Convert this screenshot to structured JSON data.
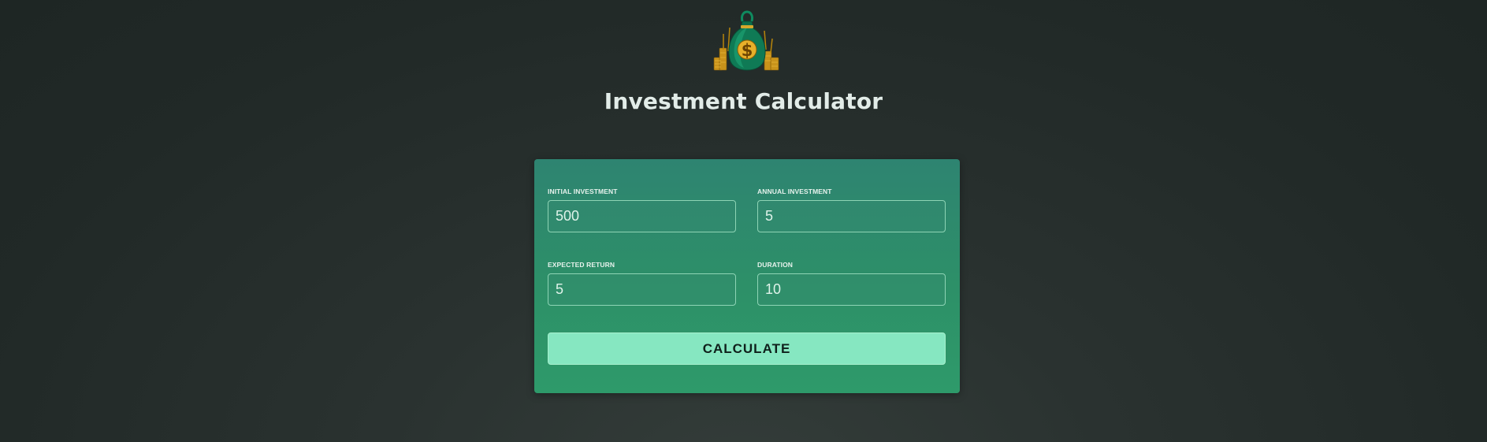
{
  "header": {
    "logo_icon": "money-bag-icon",
    "title": "Investment Calculator"
  },
  "form": {
    "initial_investment": {
      "label": "Initial Investment",
      "value": "500"
    },
    "annual_investment": {
      "label": "Annual Investment",
      "value": "5"
    },
    "expected_return": {
      "label": "Expected Return",
      "value": "5"
    },
    "duration": {
      "label": "Duration",
      "value": "10"
    },
    "calculate_label": "CALCULATE"
  },
  "colors": {
    "background": "#222a28",
    "card": "#2e8a6c",
    "button": "#86e7c1",
    "title_text": "#e2ece8"
  }
}
